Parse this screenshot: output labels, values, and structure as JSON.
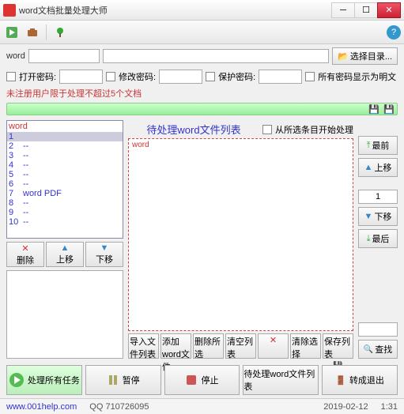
{
  "title": "word文档批量处理大师",
  "row1": {
    "label": "word",
    "select_dir": "选择目录..."
  },
  "pw": {
    "open": "打开密码:",
    "modify": "修改密码:",
    "protect": "保护密码:",
    "plain": "所有密码显示为明文"
  },
  "note": "未注册用户限于处理不超过5个文档",
  "tasks": {
    "header": "word",
    "rows": [
      {
        "n": "1",
        "t": ""
      },
      {
        "n": "2",
        "t": "--"
      },
      {
        "n": "3",
        "t": "--"
      },
      {
        "n": "4",
        "t": "--"
      },
      {
        "n": "5",
        "t": "--"
      },
      {
        "n": "6",
        "t": "--"
      },
      {
        "n": "7",
        "t": "word    PDF"
      },
      {
        "n": "8",
        "t": "--"
      },
      {
        "n": "9",
        "t": "--"
      },
      {
        "n": "10",
        "t": "--"
      }
    ]
  },
  "taskbtn": {
    "del": "删除",
    "up": "上移",
    "down": "下移"
  },
  "list": {
    "title": "待处理word文件列表",
    "from_sel": "从所选条目开始处理",
    "word": "word"
  },
  "rbtn": {
    "first": "最前",
    "up": "上移",
    "down": "下移",
    "last": "最后",
    "num": "1",
    "find": "查找"
  },
  "actions": {
    "import": "导入文件列表",
    "add": "添加word文件",
    "delsel": "删除所选",
    "clear": "清空列表",
    "delrow": "删除列表",
    "clear2": "清除选择",
    "save": "保存列表"
  },
  "footer": {
    "run": "处理所有任务",
    "pause": "暂停",
    "stop": "停止",
    "runlist": "待处理word文件列表",
    "exit": "转成退出"
  },
  "status": {
    "site": "www.001help.com",
    "qq": "QQ 710726095",
    "date": "2019-02-12",
    "time": "1:31"
  }
}
